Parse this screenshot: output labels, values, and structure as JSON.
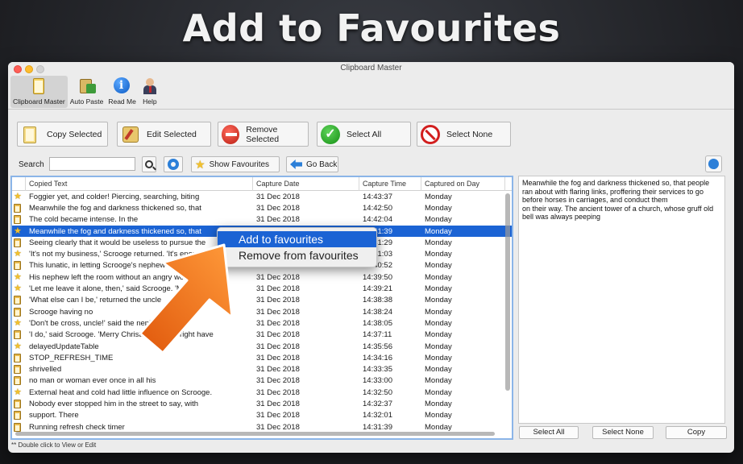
{
  "headline": "Add to Favourites",
  "window": {
    "title": "Clipboard Master"
  },
  "toolbar": [
    {
      "label": "Clipboard Master",
      "icon": "clipboard-icon",
      "active": true
    },
    {
      "label": "Auto Paste",
      "icon": "auto-paste-icon"
    },
    {
      "label": "Read Me",
      "icon": "info-icon"
    },
    {
      "label": "Help",
      "icon": "help-person-icon"
    }
  ],
  "actions": {
    "copy_selected": "Copy Selected",
    "edit_selected": "Edit Selected",
    "remove_selected": "Remove Selected",
    "select_all": "Select All",
    "select_none": "Select None"
  },
  "search": {
    "label": "Search",
    "value": "",
    "show_favourites": "Show Favourites",
    "go_back": "Go Back"
  },
  "table": {
    "columns": [
      "Copied Text",
      "Capture Date",
      "Capture Time",
      "Captured on Day"
    ],
    "rows": [
      {
        "fav": true,
        "text": "Foggier yet, and colder! Piercing, searching, biting",
        "date": "31 Dec 2018",
        "time": "14:43:37",
        "day": "Monday"
      },
      {
        "fav": false,
        "text": "Meanwhile the fog and darkness thickened so, that",
        "date": "31 Dec 2018",
        "time": "14:42:50",
        "day": "Monday"
      },
      {
        "fav": false,
        "text": "The cold became intense. In the",
        "date": "31 Dec 2018",
        "time": "14:42:04",
        "day": "Monday"
      },
      {
        "fav": true,
        "text": "Meanwhile the fog and darkness thickened so, that",
        "date": "31 Dec 2018",
        "time": "14:41:39",
        "day": "Monday",
        "selected": true
      },
      {
        "fav": false,
        "text": "Seeing clearly that it would be useless to pursue the",
        "date": "31 Dec 2018",
        "time": "14:41:29",
        "day": "Monday"
      },
      {
        "fav": true,
        "text": "'It's not my business,' Scrooge returned. 'It's enough",
        "date": "31 Dec 2018",
        "time": "14:41:03",
        "day": "Monday"
      },
      {
        "fav": false,
        "text": "This lunatic, in letting Scrooge's nephew out",
        "date": "31 Dec 2018",
        "time": "14:40:52",
        "day": "Monday"
      },
      {
        "fav": true,
        "text": "His nephew left the room without an angry word",
        "date": "31 Dec 2018",
        "time": "14:39:50",
        "day": "Monday"
      },
      {
        "fav": true,
        "text": "'Let me leave it alone, then,' said Scrooge. 'Much good",
        "date": "31 Dec 2018",
        "time": "14:39:21",
        "day": "Monday"
      },
      {
        "fav": false,
        "text": "'What else can I be,' returned the uncle",
        "date": "31 Dec 2018",
        "time": "14:38:38",
        "day": "Monday"
      },
      {
        "fav": false,
        "text": "Scrooge having no",
        "date": "31 Dec 2018",
        "time": "14:38:24",
        "day": "Monday"
      },
      {
        "fav": true,
        "text": "'Don't be cross, uncle!' said the nephew.",
        "date": "31 Dec 2018",
        "time": "14:38:05",
        "day": "Monday"
      },
      {
        "fav": false,
        "text": "'I do,' said Scrooge. 'Merry Christmas! What right have",
        "date": "31 Dec 2018",
        "time": "14:37:11",
        "day": "Monday"
      },
      {
        "fav": true,
        "text": "delayedUpdateTable",
        "date": "31 Dec 2018",
        "time": "14:35:56",
        "day": "Monday"
      },
      {
        "fav": false,
        "text": "STOP_REFRESH_TIME",
        "date": "31 Dec 2018",
        "time": "14:34:16",
        "day": "Monday"
      },
      {
        "fav": false,
        "text": "shrivelled",
        "date": "31 Dec 2018",
        "time": "14:33:35",
        "day": "Monday"
      },
      {
        "fav": false,
        "text": "no man or woman ever once in all his",
        "date": "31 Dec 2018",
        "time": "14:33:00",
        "day": "Monday"
      },
      {
        "fav": true,
        "text": "External heat and cold had little influence on Scrooge.",
        "date": "31 Dec 2018",
        "time": "14:32:50",
        "day": "Monday"
      },
      {
        "fav": false,
        "text": "Nobody ever stopped him in the street to say, with",
        "date": "31 Dec 2018",
        "time": "14:32:37",
        "day": "Monday"
      },
      {
        "fav": false,
        "text": "support. There",
        "date": "31 Dec 2018",
        "time": "14:32:01",
        "day": "Monday"
      },
      {
        "fav": false,
        "text": "Running refresh check timer",
        "date": "31 Dec 2018",
        "time": "14:31:39",
        "day": "Monday"
      }
    ]
  },
  "preview": {
    "text": "Meanwhile the fog and darkness thickened so, that people ran about with flaring links, proffering their services to go before horses in carriages, and conduct them\non their way. The ancient tower of a church, whose gruff old bell was always peeping"
  },
  "preview_buttons": {
    "select_all": "Select All",
    "select_none": "Select None",
    "copy": "Copy"
  },
  "footnote": "** Double click to View or Edit",
  "context_menu": [
    {
      "label": "Add to favourites",
      "highlighted": true
    },
    {
      "label": "Remove from favourites",
      "highlighted": false
    }
  ],
  "colors": {
    "selection": "#1b63d4",
    "favourite_star": "#f2c12e",
    "callout_arrow": "#f07a1c"
  }
}
